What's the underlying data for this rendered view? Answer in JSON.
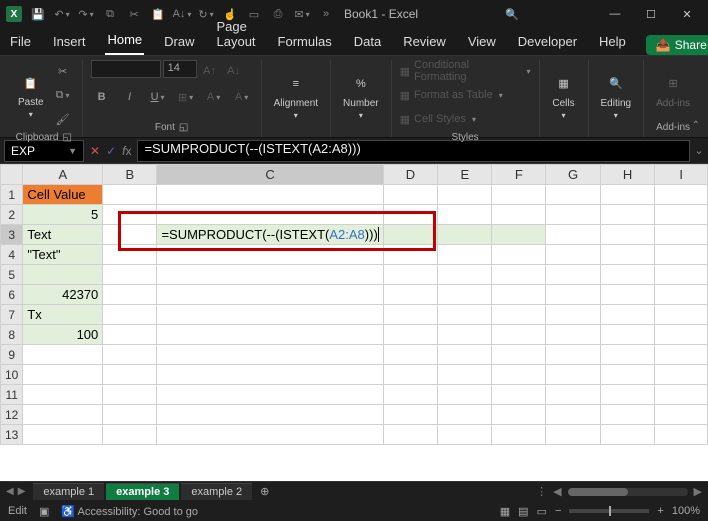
{
  "title": "Book1 - Excel",
  "tabs": {
    "file": "File",
    "insert": "Insert",
    "home": "Home",
    "draw": "Draw",
    "pagelayout": "Page Layout",
    "formulas": "Formulas",
    "data": "Data",
    "review": "Review",
    "view": "View",
    "developer": "Developer",
    "help": "Help"
  },
  "share": "Share",
  "ribbon": {
    "font_size": "14",
    "clipboard": "Clipboard",
    "paste": "Paste",
    "font": "Font",
    "alignment": "Alignment",
    "number": "Number",
    "styles": "Styles",
    "cond_fmt": "Conditional Formatting",
    "fmt_table": "Format as Table",
    "cell_styles": "Cell Styles",
    "cells": "Cells",
    "editing": "Editing",
    "addins": "Add-ins"
  },
  "namebox": "EXP",
  "formula": "=SUMPRODUCT(--(ISTEXT(A2:A8)))",
  "formula_parts": {
    "pre": "=SUMPRODUCT(--(ISTEXT(",
    "ref": "A2:A8",
    "post": ")))"
  },
  "columns": [
    "A",
    "B",
    "C",
    "D",
    "E",
    "F",
    "G",
    "H",
    "I"
  ],
  "rows": [
    "1",
    "2",
    "3",
    "4",
    "5",
    "6",
    "7",
    "8",
    "9",
    "10",
    "11",
    "12",
    "13"
  ],
  "cells": {
    "A1": "Cell Value",
    "A2": "5",
    "A3": "Text",
    "A4": "\"Text\"",
    "A5": "",
    "A6": "42370",
    "A7": "Tx",
    "A8": "100"
  },
  "sheets": {
    "s1": "example 1",
    "s2": "example 3",
    "s3": "example 2"
  },
  "status": {
    "mode": "Edit",
    "acc": "Accessibility: Good to go",
    "zoom": "100%"
  },
  "chart_data": null
}
